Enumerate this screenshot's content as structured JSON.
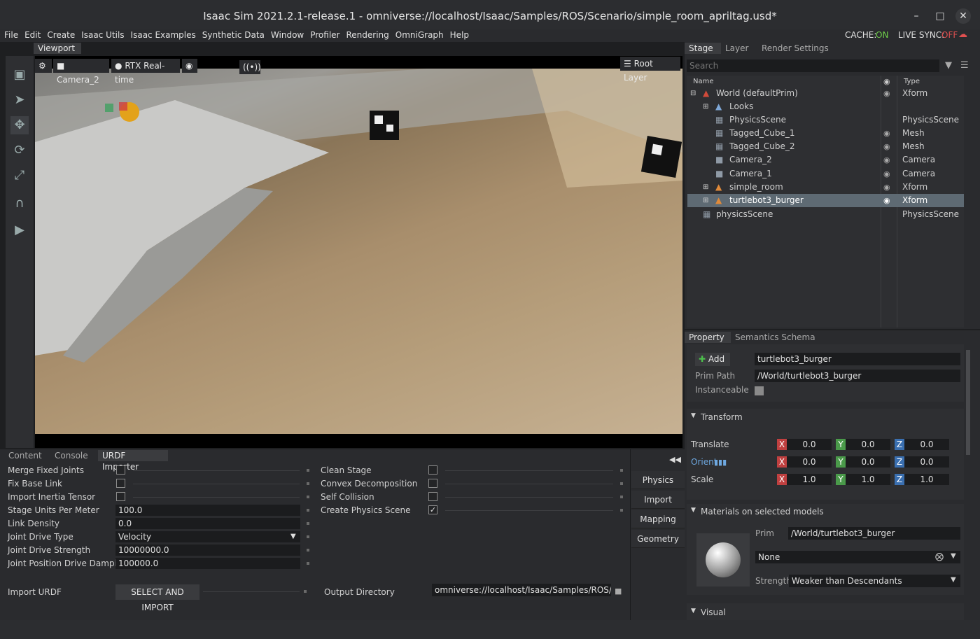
{
  "window": {
    "title": "Isaac Sim 2021.2.1-release.1 - omniverse://localhost/Isaac/Samples/ROS/Scenario/simple_room_apriltag.usd*"
  },
  "menu": [
    "File",
    "Edit",
    "Create",
    "Isaac Utils",
    "Isaac Examples",
    "Synthetic Data",
    "Window",
    "Profiler",
    "Rendering",
    "OmniGraph",
    "Help"
  ],
  "status_indicators": {
    "cache_label": "CACHE:",
    "cache_value": "ON",
    "cache_color": "#6fcf4a",
    "live_sync_label": "LIVE SYNC:",
    "live_sync_value": "OFF",
    "live_sync_color": "#e05050"
  },
  "viewport": {
    "tab": "Viewport",
    "camera": "Camera_2",
    "renderer": "RTX Real-time",
    "layer": "Root Layer"
  },
  "stage": {
    "tabs": [
      "Stage",
      "Layer",
      "Render Settings"
    ],
    "search_placeholder": "Search",
    "col_name": "Name",
    "col_type": "Type",
    "items": [
      {
        "name": "World (defaultPrim)",
        "type": "Xform",
        "visible": true,
        "selected": false
      },
      {
        "name": "Looks",
        "type": "",
        "visible": false,
        "selected": false
      },
      {
        "name": "PhysicsScene",
        "type": "PhysicsScene",
        "visible": false,
        "selected": false
      },
      {
        "name": "Tagged_Cube_1",
        "type": "Mesh",
        "visible": true,
        "selected": false
      },
      {
        "name": "Tagged_Cube_2",
        "type": "Mesh",
        "visible": true,
        "selected": false
      },
      {
        "name": "Camera_2",
        "type": "Camera",
        "visible": true,
        "selected": false
      },
      {
        "name": "Camera_1",
        "type": "Camera",
        "visible": true,
        "selected": false
      },
      {
        "name": "simple_room",
        "type": "Xform",
        "visible": true,
        "selected": false
      },
      {
        "name": "turtlebot3_burger",
        "type": "Xform",
        "visible": true,
        "selected": true
      },
      {
        "name": "physicsScene",
        "type": "PhysicsScene",
        "visible": false,
        "selected": false
      }
    ]
  },
  "property": {
    "tabs": [
      "Property",
      "Semantics Schema Editor"
    ],
    "add_label": "Add",
    "prim_name": "turtlebot3_burger",
    "prim_path_label": "Prim Path",
    "prim_path": "/World/turtlebot3_burger",
    "instanceable_label": "Instanceable",
    "transform_label": "Transform",
    "translate_label": "Translate",
    "orient_label": "Orient",
    "scale_label": "Scale",
    "translate": [
      "0.0",
      "0.0",
      "0.0"
    ],
    "orient": [
      "0.0",
      "0.0",
      "0.0"
    ],
    "scale": [
      "1.0",
      "1.0",
      "1.0"
    ],
    "axes": [
      "X",
      "Y",
      "Z"
    ],
    "materials_label": "Materials on selected models",
    "mat_prim_label": "Prim",
    "mat_prim": "/World/turtlebot3_burger",
    "mat_value": "None",
    "strength_label": "Strength",
    "strength_value": "Weaker than Descendants",
    "visual_label": "Visual"
  },
  "bottom": {
    "tabs": [
      "Content",
      "Console",
      "URDF Importer"
    ],
    "merge_fixed_joints": "Merge Fixed Joints",
    "fix_base_link": "Fix Base Link",
    "import_inertia": "Import Inertia Tensor",
    "stage_units": "Stage Units Per Meter",
    "stage_units_value": "100.0",
    "link_density": "Link Density",
    "link_density_value": "0.0",
    "joint_drive_type": "Joint Drive Type",
    "joint_drive_type_value": "Velocity",
    "joint_drive_strength": "Joint Drive Strength",
    "joint_drive_strength_value": "10000000.0",
    "joint_pos_damping": "Joint Position Drive Damping",
    "joint_pos_damping_value": "100000.0",
    "clean_stage": "Clean Stage",
    "convex_decomp": "Convex Decomposition",
    "self_collision": "Self Collision",
    "create_physics": "Create Physics Scene",
    "import_urdf": "Import URDF",
    "select_import": "SELECT AND IMPORT",
    "output_dir": "Output Directory",
    "output_dir_value": "omniverse://localhost/Isaac/Samples/ROS/Scer",
    "side_buttons": [
      "Physics",
      "Import",
      "Mapping",
      "Geometry"
    ]
  }
}
